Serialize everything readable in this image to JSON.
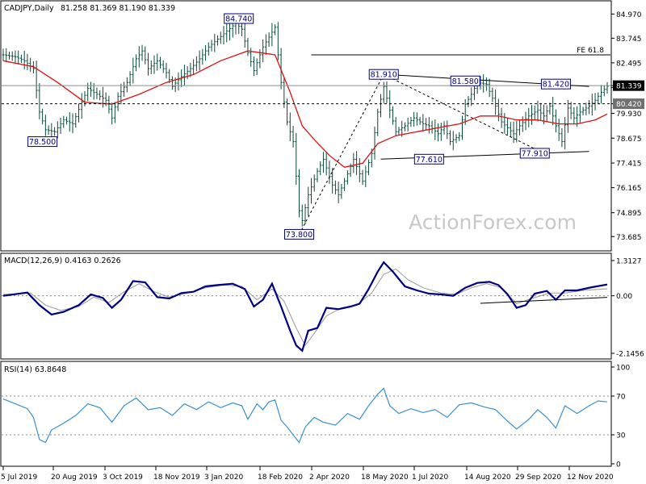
{
  "header": {
    "symbol": "CADJPY,Daily",
    "ohlc": "81.258 81.369 81.190 81.339"
  },
  "watermark": "ActionForex.com",
  "colors": {
    "bars": "#0a4a3a",
    "ma": "#e01010",
    "ref_line": "#000000",
    "macd": "#000080",
    "signal": "#999999",
    "rsi": "#3a8fd0",
    "label_border": "#000080",
    "price_badge": "#000000"
  },
  "chart_data": [
    {
      "type": "line",
      "name": "price",
      "title": "CADJPY,Daily",
      "ylim": [
        73.0,
        85.6
      ],
      "y_ticks": [
        "84.970",
        "83.745",
        "82.495",
        "81.245",
        "79.930",
        "78.675",
        "77.415",
        "76.165",
        "74.895",
        "73.685"
      ],
      "x_ticks": [
        "5 Jul 2019",
        "20 Aug 2019",
        "3 Oct 2019",
        "18 Nov 2019",
        "3 Jan 2020",
        "18 Feb 2020",
        "2 Apr 2020",
        "18 May 2020",
        "1 Jul 2020",
        "14 Aug 2020",
        "29 Sep 2020",
        "12 Nov 2020"
      ],
      "close_path": [
        [
          0,
          82.9
        ],
        [
          4,
          82.8
        ],
        [
          7,
          82.6
        ],
        [
          10,
          82.2
        ],
        [
          12,
          80.0
        ],
        [
          14,
          79.1
        ],
        [
          17,
          79.0
        ],
        [
          20,
          79.6
        ],
        [
          23,
          79.4
        ],
        [
          26,
          80.5
        ],
        [
          28,
          81.2
        ],
        [
          31,
          80.9
        ],
        [
          34,
          80.6
        ],
        [
          36,
          79.7
        ],
        [
          38,
          80.8
        ],
        [
          41,
          81.5
        ],
        [
          44,
          82.7
        ],
        [
          46,
          83.1
        ],
        [
          48,
          82.2
        ],
        [
          51,
          82.6
        ],
        [
          54,
          82.0
        ],
        [
          56,
          81.3
        ],
        [
          59,
          81.8
        ],
        [
          62,
          82.2
        ],
        [
          65,
          82.7
        ],
        [
          68,
          83.3
        ],
        [
          71,
          83.7
        ],
        [
          74,
          84.1
        ],
        [
          77,
          84.5
        ],
        [
          79,
          84.2
        ],
        [
          81,
          83.0
        ],
        [
          83,
          82.1
        ],
        [
          86,
          83.3
        ],
        [
          88,
          83.8
        ],
        [
          90,
          84.3
        ],
        [
          92,
          81.5
        ],
        [
          94,
          79.5
        ],
        [
          96,
          78.5
        ],
        [
          98,
          75.0
        ],
        [
          99,
          74.5
        ],
        [
          101,
          75.8
        ],
        [
          104,
          77.0
        ],
        [
          106,
          77.6
        ],
        [
          109,
          76.3
        ],
        [
          111,
          75.8
        ],
        [
          113,
          76.5
        ],
        [
          116,
          77.6
        ],
        [
          119,
          76.5
        ],
        [
          122,
          77.9
        ],
        [
          124,
          80.0
        ],
        [
          126,
          81.3
        ],
        [
          128,
          80.1
        ],
        [
          130,
          79.0
        ],
        [
          133,
          79.3
        ],
        [
          136,
          79.7
        ],
        [
          139,
          79.4
        ],
        [
          141,
          79.3
        ],
        [
          144,
          78.9
        ],
        [
          146,
          79.3
        ],
        [
          148,
          78.5
        ],
        [
          151,
          78.8
        ],
        [
          153,
          80.4
        ],
        [
          155,
          80.9
        ],
        [
          157,
          81.5
        ],
        [
          160,
          81.4
        ],
        [
          162,
          80.7
        ],
        [
          165,
          79.5
        ],
        [
          167,
          79.2
        ],
        [
          169,
          78.9
        ],
        [
          171,
          79.3
        ],
        [
          174,
          79.8
        ],
        [
          177,
          80.1
        ],
        [
          179,
          79.8
        ],
        [
          181,
          80.3
        ],
        [
          183,
          79.3
        ],
        [
          185,
          78.5
        ],
        [
          187,
          80.2
        ],
        [
          189,
          79.7
        ],
        [
          191,
          80.0
        ],
        [
          194,
          80.3
        ],
        [
          196,
          80.6
        ],
        [
          198,
          81.0
        ],
        [
          200,
          81.3
        ]
      ],
      "ma_path": [
        [
          0,
          82.6
        ],
        [
          10,
          82.3
        ],
        [
          18,
          81.5
        ],
        [
          27,
          80.5
        ],
        [
          36,
          80.4
        ],
        [
          45,
          80.9
        ],
        [
          54,
          81.5
        ],
        [
          63,
          81.9
        ],
        [
          72,
          82.6
        ],
        [
          81,
          83.1
        ],
        [
          90,
          82.9
        ],
        [
          95,
          81.0
        ],
        [
          99,
          79.3
        ],
        [
          103,
          78.6
        ],
        [
          108,
          77.8
        ],
        [
          113,
          77.2
        ],
        [
          119,
          77.4
        ],
        [
          124,
          78.4
        ],
        [
          130,
          78.8
        ],
        [
          137,
          79.0
        ],
        [
          144,
          79.2
        ],
        [
          151,
          79.4
        ],
        [
          158,
          79.8
        ],
        [
          164,
          79.8
        ],
        [
          170,
          79.6
        ],
        [
          177,
          79.6
        ],
        [
          184,
          79.4
        ],
        [
          190,
          79.4
        ],
        [
          196,
          79.6
        ],
        [
          200,
          79.9
        ]
      ],
      "levels": [
        {
          "label": "FE 61.8",
          "value": 82.9
        },
        {
          "label": "81.339",
          "value": 81.339
        },
        {
          "label": "80.420",
          "value": 80.42
        }
      ],
      "annotations": [
        {
          "text": "84.740",
          "x": 78,
          "y": 84.74
        },
        {
          "text": "78.500",
          "x": 13,
          "y": 78.5
        },
        {
          "text": "73.800",
          "x": 98,
          "y": 73.8
        },
        {
          "text": "81.910",
          "x": 126,
          "y": 81.91
        },
        {
          "text": "81.580",
          "x": 153,
          "y": 81.58
        },
        {
          "text": "81.420",
          "x": 183,
          "y": 81.42
        },
        {
          "text": "77.610",
          "x": 141,
          "y": 77.61
        },
        {
          "text": "77.910",
          "x": 176,
          "y": 77.91
        }
      ],
      "trendlines": [
        {
          "from": [
            126,
            81.91
          ],
          "to": [
            194,
            81.3
          ],
          "style": "solid"
        },
        {
          "from": [
            125,
            77.61
          ],
          "to": [
            194,
            78.0
          ],
          "style": "solid"
        },
        {
          "from": [
            98,
            73.8
          ],
          "to": [
            126,
            81.91
          ],
          "style": "dashed"
        },
        {
          "from": [
            126,
            81.91
          ],
          "to": [
            179,
            77.91
          ],
          "style": "dashed"
        }
      ]
    },
    {
      "type": "line",
      "name": "macd",
      "title": "MACD(12,26,9) 0.4163 0.2626",
      "ylim": [
        -2.1456,
        1.3127
      ],
      "y_ticks": [
        "1.3127",
        "0.00",
        "-2.1456"
      ],
      "macd_path": [
        [
          0,
          0.0
        ],
        [
          8,
          0.12
        ],
        [
          12,
          -0.35
        ],
        [
          16,
          -0.7
        ],
        [
          20,
          -0.6
        ],
        [
          25,
          -0.35
        ],
        [
          29,
          0.05
        ],
        [
          33,
          -0.08
        ],
        [
          36,
          -0.45
        ],
        [
          39,
          -0.15
        ],
        [
          43,
          0.55
        ],
        [
          47,
          0.5
        ],
        [
          51,
          -0.05
        ],
        [
          55,
          -0.1
        ],
        [
          59,
          0.1
        ],
        [
          63,
          0.15
        ],
        [
          67,
          0.35
        ],
        [
          71,
          0.4
        ],
        [
          76,
          0.45
        ],
        [
          80,
          0.25
        ],
        [
          83,
          -0.4
        ],
        [
          86,
          -0.15
        ],
        [
          89,
          0.45
        ],
        [
          92,
          -0.4
        ],
        [
          95,
          -1.3
        ],
        [
          97,
          -1.85
        ],
        [
          99,
          -2.05
        ],
        [
          101,
          -1.3
        ],
        [
          104,
          -1.2
        ],
        [
          107,
          -0.45
        ],
        [
          111,
          -0.5
        ],
        [
          115,
          -0.4
        ],
        [
          118,
          -0.3
        ],
        [
          121,
          0.25
        ],
        [
          124,
          0.9
        ],
        [
          126,
          1.25
        ],
        [
          129,
          0.9
        ],
        [
          133,
          0.35
        ],
        [
          137,
          0.2
        ],
        [
          141,
          0.08
        ],
        [
          145,
          0.05
        ],
        [
          149,
          0.0
        ],
        [
          153,
          0.3
        ],
        [
          157,
          0.48
        ],
        [
          161,
          0.52
        ],
        [
          164,
          0.4
        ],
        [
          167,
          0.05
        ],
        [
          170,
          -0.45
        ],
        [
          173,
          -0.35
        ],
        [
          176,
          0.08
        ],
        [
          180,
          0.18
        ],
        [
          183,
          -0.15
        ],
        [
          186,
          0.2
        ],
        [
          190,
          0.2
        ],
        [
          195,
          0.32
        ],
        [
          200,
          0.42
        ]
      ],
      "signal_path": [
        [
          0,
          0.05
        ],
        [
          9,
          0.1
        ],
        [
          14,
          -0.35
        ],
        [
          19,
          -0.55
        ],
        [
          25,
          -0.4
        ],
        [
          30,
          -0.05
        ],
        [
          35,
          -0.25
        ],
        [
          40,
          0.15
        ],
        [
          45,
          0.45
        ],
        [
          50,
          0.15
        ],
        [
          55,
          -0.05
        ],
        [
          61,
          0.1
        ],
        [
          67,
          0.3
        ],
        [
          73,
          0.4
        ],
        [
          79,
          0.35
        ],
        [
          84,
          -0.15
        ],
        [
          89,
          0.25
        ],
        [
          93,
          -0.2
        ],
        [
          97,
          -1.2
        ],
        [
          100,
          -1.85
        ],
        [
          103,
          -1.4
        ],
        [
          107,
          -0.75
        ],
        [
          112,
          -0.45
        ],
        [
          117,
          -0.35
        ],
        [
          122,
          0.1
        ],
        [
          126,
          0.8
        ],
        [
          130,
          1.0
        ],
        [
          134,
          0.6
        ],
        [
          139,
          0.3
        ],
        [
          145,
          0.1
        ],
        [
          150,
          0.05
        ],
        [
          155,
          0.3
        ],
        [
          160,
          0.45
        ],
        [
          165,
          0.3
        ],
        [
          170,
          -0.3
        ],
        [
          175,
          -0.1
        ],
        [
          181,
          0.1
        ],
        [
          186,
          0.1
        ],
        [
          192,
          0.2
        ],
        [
          200,
          0.26
        ]
      ],
      "trendline": {
        "from": [
          158,
          -0.28
        ],
        "to": [
          200,
          -0.06
        ]
      }
    },
    {
      "type": "line",
      "name": "rsi",
      "title": "RSI(14) 63.8648",
      "ylim": [
        0,
        100
      ],
      "y_ticks": [
        "100",
        "70",
        "30",
        "0"
      ],
      "levels": [
        70,
        30
      ],
      "rsi_path": [
        [
          0,
          67
        ],
        [
          4,
          62
        ],
        [
          8,
          57
        ],
        [
          10,
          48
        ],
        [
          12,
          25
        ],
        [
          14,
          22
        ],
        [
          16,
          35
        ],
        [
          20,
          42
        ],
        [
          24,
          50
        ],
        [
          28,
          62
        ],
        [
          32,
          58
        ],
        [
          36,
          43
        ],
        [
          40,
          60
        ],
        [
          44,
          68
        ],
        [
          48,
          56
        ],
        [
          52,
          58
        ],
        [
          56,
          50
        ],
        [
          60,
          62
        ],
        [
          64,
          56
        ],
        [
          68,
          64
        ],
        [
          72,
          58
        ],
        [
          76,
          63
        ],
        [
          79,
          60
        ],
        [
          81,
          46
        ],
        [
          84,
          62
        ],
        [
          86,
          56
        ],
        [
          88,
          64
        ],
        [
          90,
          66
        ],
        [
          92,
          45
        ],
        [
          94,
          38
        ],
        [
          96,
          30
        ],
        [
          98,
          22
        ],
        [
          100,
          38
        ],
        [
          103,
          48
        ],
        [
          106,
          43
        ],
        [
          110,
          40
        ],
        [
          114,
          52
        ],
        [
          118,
          46
        ],
        [
          121,
          60
        ],
        [
          124,
          72
        ],
        [
          126,
          78
        ],
        [
          128,
          60
        ],
        [
          131,
          52
        ],
        [
          135,
          57
        ],
        [
          139,
          53
        ],
        [
          143,
          56
        ],
        [
          147,
          48
        ],
        [
          151,
          61
        ],
        [
          155,
          63
        ],
        [
          159,
          59
        ],
        [
          163,
          56
        ],
        [
          167,
          44
        ],
        [
          170,
          36
        ],
        [
          174,
          46
        ],
        [
          177,
          56
        ],
        [
          180,
          48
        ],
        [
          183,
          37
        ],
        [
          186,
          60
        ],
        [
          190,
          52
        ],
        [
          194,
          60
        ],
        [
          197,
          65
        ],
        [
          200,
          64
        ]
      ]
    }
  ]
}
